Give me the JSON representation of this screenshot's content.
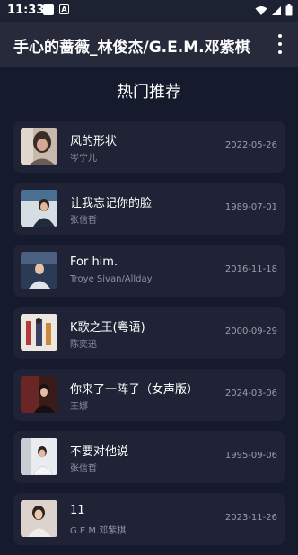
{
  "status_bar": {
    "time": "11:33"
  },
  "app_bar": {
    "title": "手心的蔷薇_林俊杰/G.E.M.邓紫棋"
  },
  "section_title": "热门推荐",
  "songs": [
    {
      "title": "风的形状",
      "artist": "岑宁儿",
      "date": "2022-05-26"
    },
    {
      "title": "让我忘记你的脸",
      "artist": "张信哲",
      "date": "1989-07-01"
    },
    {
      "title": "For him.",
      "artist": "Troye Sivan/Allday",
      "date": "2016-11-18"
    },
    {
      "title": "K歌之王(粤语)",
      "artist": "陈奕迅",
      "date": "2000-09-29"
    },
    {
      "title": "你来了一阵子（女声版）",
      "artist": "王娜",
      "date": "2024-03-06"
    },
    {
      "title": "不要对他说",
      "artist": "张信哲",
      "date": "1995-09-06"
    },
    {
      "title": "11",
      "artist": "G.E.M.邓紫棋",
      "date": "2023-11-26"
    }
  ]
}
